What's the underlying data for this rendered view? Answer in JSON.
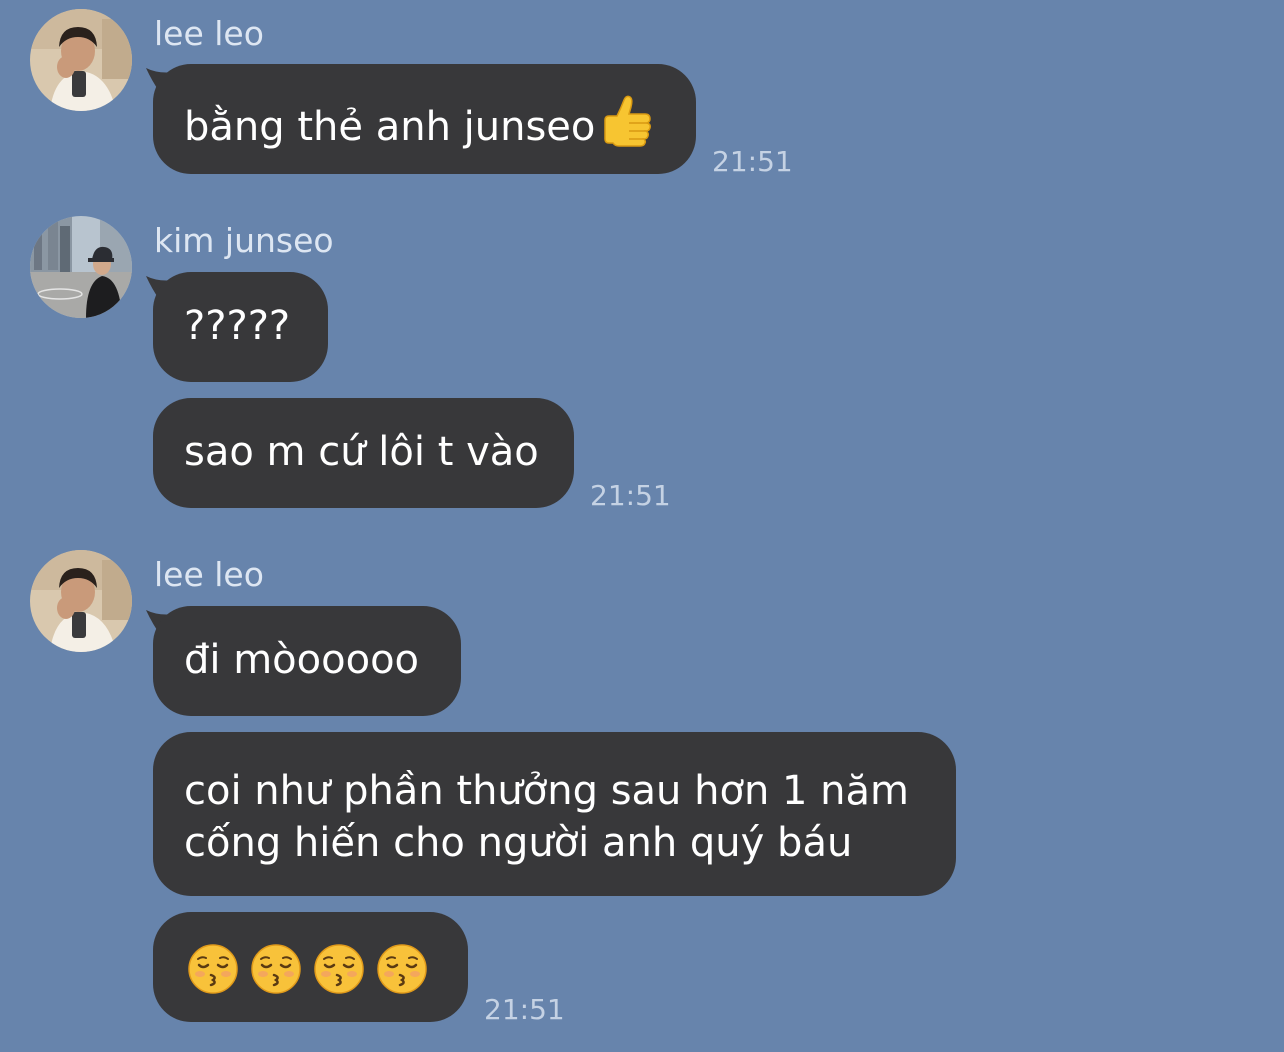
{
  "conversation": {
    "groups": [
      {
        "sender": "lee leo",
        "avatar": "lee-leo-avatar",
        "messages": [
          {
            "text": "bằng thẻ anh junseo",
            "trailing_emoji": "thumbs-up-icon"
          }
        ],
        "time": "21:51"
      },
      {
        "sender": "kim junseo",
        "avatar": "kim-junseo-avatar",
        "messages": [
          {
            "text": "?????"
          },
          {
            "text": "sao m cứ lôi t vào"
          }
        ],
        "time": "21:51"
      },
      {
        "sender": "lee leo",
        "avatar": "lee-leo-avatar",
        "messages": [
          {
            "text": "đi mòooooo"
          },
          {
            "line1": "coi như phần thưởng sau hơn 1 năm",
            "line2": "cống hiến cho người anh quý báu"
          },
          {
            "emoji": [
              "kissing-face-icon",
              "kissing-face-icon",
              "kissing-face-icon",
              "kissing-face-icon"
            ]
          }
        ],
        "time": "21:51"
      }
    ]
  },
  "colors": {
    "background": "#6784ac",
    "bubble": "#38383a",
    "bubble_text": "#ffffff",
    "sender_text": "#dde6f2",
    "timestamp_text": "#c5d2e4"
  }
}
